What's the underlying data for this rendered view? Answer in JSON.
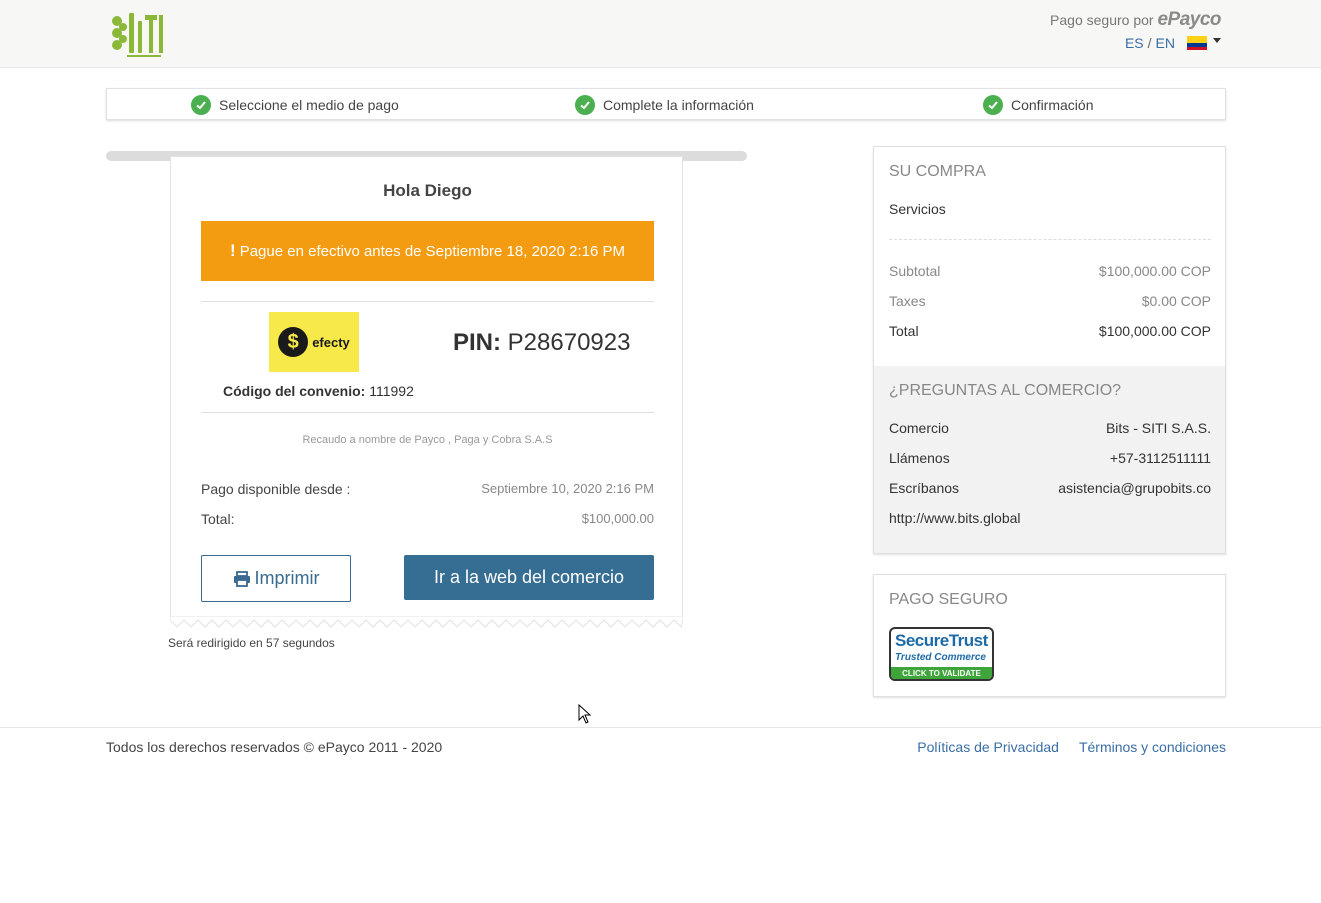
{
  "header": {
    "logo_alt": "Bits",
    "secure_label": "Pago seguro por",
    "brand": "ePayco",
    "lang_es": "ES",
    "lang_sep": "/",
    "lang_en": "EN"
  },
  "steps": [
    {
      "label": "Seleccione el medio de pago"
    },
    {
      "label": "Complete la información"
    },
    {
      "label": "Confirmación"
    }
  ],
  "receipt": {
    "greeting": "Hola Diego",
    "alert": "Pague en efectivo antes de Septiembre 18, 2020 2:16 PM",
    "alert_icon": "!",
    "provider": "efecty",
    "pin_label": "PIN:",
    "pin_value": "P28670923",
    "convenio_label": "Código del convenio:",
    "convenio_value": "111992",
    "recaudo": "Recaudo a nombre de Payco , Paga y Cobra S.A.S",
    "available_label": "Pago disponible desde :",
    "available_value": "Septiembre 10, 2020 2:16 PM",
    "total_label": "Total:",
    "total_value": "$100,000.00",
    "print_label": "Imprimir",
    "web_label": "Ir a la web del comercio",
    "redirect": "Será redirigido en 57 segundos"
  },
  "purchase": {
    "title": "SU COMPRA",
    "item": "Servicios",
    "subtotal_label": "Subtotal",
    "subtotal_value": "$100,000.00 COP",
    "taxes_label": "Taxes",
    "taxes_value": "$0.00 COP",
    "total_label": "Total",
    "total_value": "$100,000.00 COP"
  },
  "questions": {
    "title": "¿PREGUNTAS AL COMERCIO?",
    "commerce_label": "Comercio",
    "commerce_value": "Bits - SITI S.A.S.",
    "call_label": "Llámenos",
    "call_value": "+57-3112511111",
    "write_label": "Escríbanos",
    "write_value": "asistencia@grupobits.co",
    "website": "http://www.bits.global"
  },
  "secure": {
    "title": "PAGO SEGURO",
    "badge_line1": "SecureTrust",
    "badge_line2": "Trusted Commerce",
    "badge_line3": "CLICK TO VALIDATE"
  },
  "footer": {
    "copyright": "Todos los derechos reservados © ePayco 2011 - 2020",
    "privacy": "Políticas de Privacidad",
    "terms": "Términos y condiciones"
  },
  "colors": {
    "accent": "#356d93",
    "alert": "#f39c12",
    "check": "#4caf50"
  }
}
